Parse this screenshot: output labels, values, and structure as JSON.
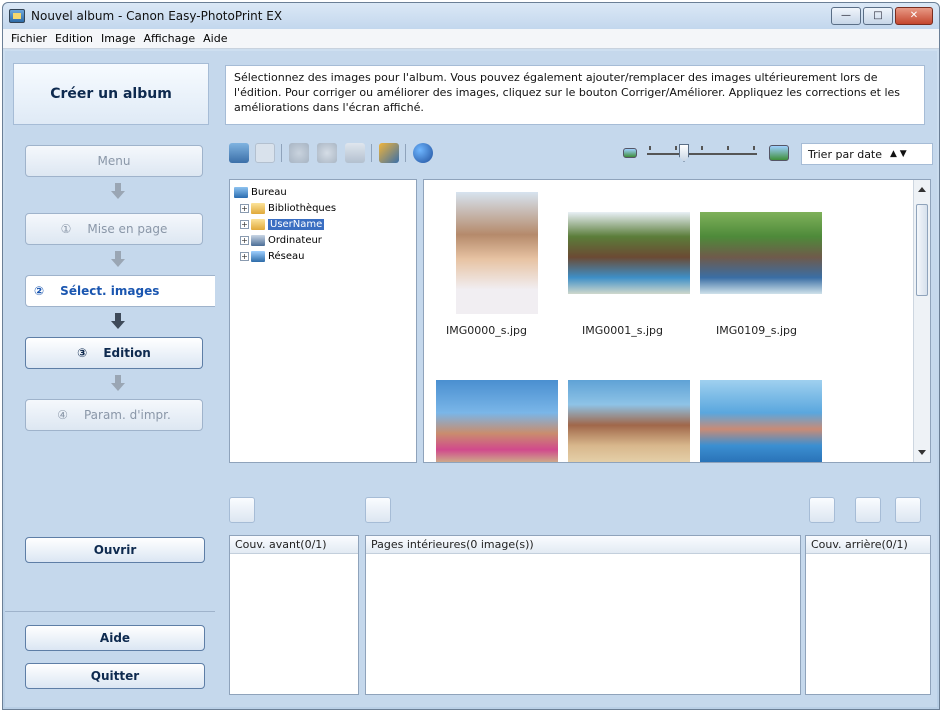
{
  "window": {
    "title": "Nouvel album - Canon Easy-PhotoPrint EX",
    "minimize_glyph": "—",
    "maximize_glyph": "□",
    "close_glyph": "✕"
  },
  "menubar": {
    "items": [
      "Fichier",
      "Edition",
      "Image",
      "Affichage",
      "Aide"
    ]
  },
  "left": {
    "header": "Créer un album",
    "steps": [
      {
        "label": "Menu",
        "num": "",
        "state": "disabled"
      },
      {
        "label": "Mise en page",
        "num": "①",
        "state": "disabled"
      },
      {
        "label": "Sélect. images",
        "num": "②",
        "state": "active"
      },
      {
        "label": "Edition",
        "num": "③",
        "state": "enabled"
      },
      {
        "label": "Param. d'impr.",
        "num": "④",
        "state": "disabled"
      }
    ],
    "open_button": "Ouvrir",
    "help_button": "Aide",
    "quit_button": "Quitter"
  },
  "instructions": "Sélectionnez des images pour l'album. Vous pouvez également ajouter/remplacer des images ultérieurement lors de l'édition. Pour corriger ou améliorer des images, cliquez sur le bouton Corriger/Améliorer. Appliquez les corrections et les améliorations dans l'écran affiché.",
  "toolbar": {
    "sort_label": "Trier par date",
    "sort_arrows": "▲ ▼",
    "icons": [
      "select-all-icon",
      "deselect-all-icon",
      "correct-enhance-icon",
      "rotate-icon",
      "image-properties-icon",
      "special-filters-icon",
      "internet-icon"
    ],
    "zoom_level": 0.3
  },
  "tree": {
    "items": [
      {
        "label": "Bureau",
        "level": 0,
        "expander": "",
        "icon": "desktop-icon",
        "selected": false
      },
      {
        "label": "Bibliothèques",
        "level": 1,
        "expander": "+",
        "icon": "library-folder-icon",
        "selected": false
      },
      {
        "label": "UserName",
        "level": 1,
        "expander": "+",
        "icon": "user-folder-icon",
        "selected": true
      },
      {
        "label": "Ordinateur",
        "level": 1,
        "expander": "+",
        "icon": "computer-icon",
        "selected": false
      },
      {
        "label": "Réseau",
        "level": 1,
        "expander": "+",
        "icon": "network-icon",
        "selected": false
      }
    ]
  },
  "thumbnails": [
    {
      "caption": "IMG0000_s.jpg"
    },
    {
      "caption": "IMG0001_s.jpg"
    },
    {
      "caption": "IMG0109_s.jpg"
    },
    {
      "caption": ""
    },
    {
      "caption": ""
    },
    {
      "caption": ""
    }
  ],
  "panels": {
    "front_cover": "Couv. avant(0/1)",
    "inner_pages": "Pages intérieures(0 image(s))",
    "back_cover": "Couv. arrière(0/1)"
  },
  "colors": {
    "accent": "#1a56b0",
    "selection": "#3a6ec2",
    "pane_bg": "#c5d8ec"
  }
}
